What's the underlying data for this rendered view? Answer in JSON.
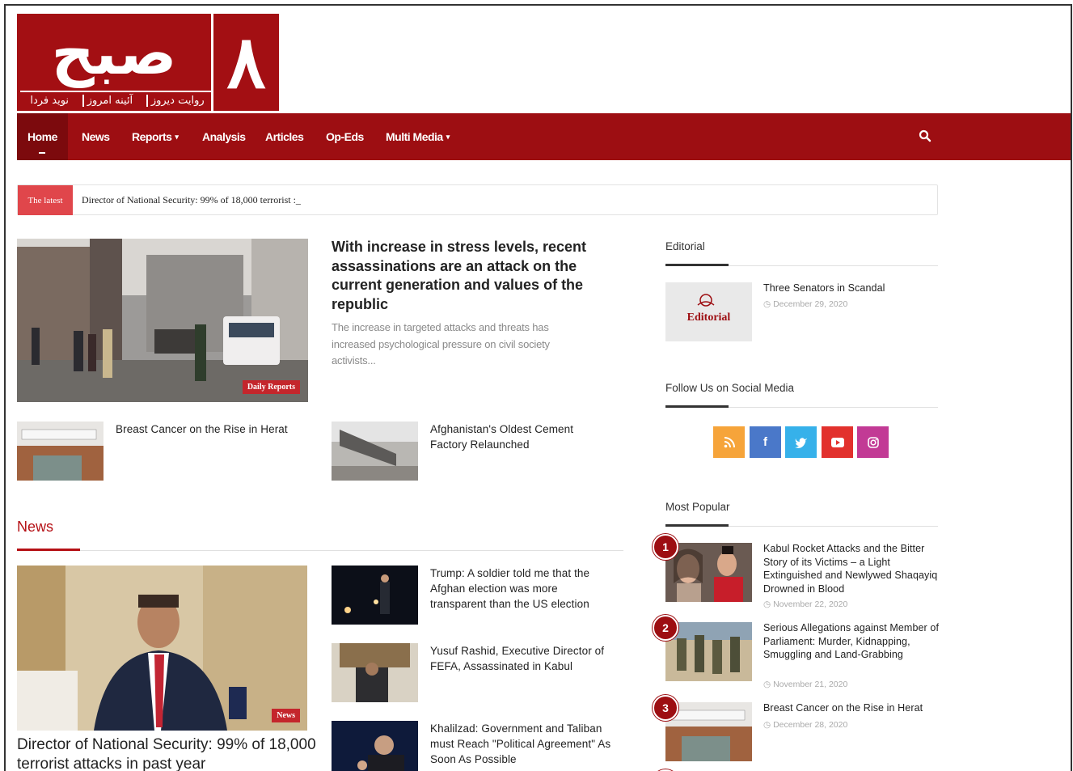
{
  "logo": {
    "main": "صبح",
    "number": "۸",
    "tagline": [
      "روایت دیروز",
      "آئینه امروز",
      "نوید فردا"
    ]
  },
  "nav": {
    "items": [
      {
        "label": "Home",
        "active": true
      },
      {
        "label": "News"
      },
      {
        "label": "Reports",
        "dropdown": true
      },
      {
        "label": "Analysis"
      },
      {
        "label": "Articles"
      },
      {
        "label": "Op-Eds"
      },
      {
        "label": "Multi Media",
        "dropdown": true
      }
    ],
    "search_icon": "search-icon",
    "caret": "▾"
  },
  "ticker": {
    "label": "The latest",
    "text": "Director of National Security: 99% of 18,000 terrorist :_"
  },
  "featured": {
    "badge": "Daily Reports",
    "title": "With increase in stress levels, recent assassinations are an attack on the current generation and values of the republic",
    "excerpt": "The increase in targeted attacks and threats has increased psychological pressure on civil society activists..."
  },
  "small_posts": [
    {
      "title": "Breast Cancer on the Rise in Herat"
    },
    {
      "title": "Afghanistan's Oldest Cement Factory Relaunched"
    }
  ],
  "news": {
    "section_title": "News",
    "main": {
      "badge": "News",
      "title": "Director of National Security: 99% of 18,000 terrorist attacks in past year"
    },
    "list": [
      {
        "title": "Trump: A soldier told me that the Afghan election was more transparent than the US election"
      },
      {
        "title": "Yusuf Rashid, Executive Director of FEFA, Assassinated in Kabul"
      },
      {
        "title": "Khalilzad: Government and Taliban must Reach \"Political Agreement\" As Soon As Possible"
      }
    ]
  },
  "sidebar": {
    "editorial": {
      "section_title": "Editorial",
      "thumb_label": "Editorial",
      "title": "Three Senators in Scandal",
      "date": "December 29, 2020"
    },
    "social": {
      "section_title": "Follow Us on Social Media",
      "icons": [
        {
          "name": "rss-icon",
          "glyph": "⌇",
          "color": "#f6a43a"
        },
        {
          "name": "facebook-icon",
          "glyph": "f",
          "color": "#4a78c9"
        },
        {
          "name": "twitter-icon",
          "glyph": "✦",
          "color": "#36b1ea"
        },
        {
          "name": "youtube-icon",
          "glyph": "▶",
          "color": "#e2312d"
        },
        {
          "name": "instagram-icon",
          "glyph": "◎",
          "color": "#c23a95"
        }
      ]
    },
    "popular": {
      "section_title": "Most Popular",
      "items": [
        {
          "rank": "1",
          "title": "Kabul Rocket Attacks and the Bitter Story of its Victims – a Light Extinguished and Newlywed Shaqayiq Drowned in Blood",
          "date": "November 22, 2020"
        },
        {
          "rank": "2",
          "title": "Serious Allegations against Member of Parliament: Murder, Kidnapping, Smuggling and Land-Grabbing",
          "date": "November 21, 2020"
        },
        {
          "rank": "3",
          "title": "Breast Cancer on the Rise in Herat",
          "date": "December 28, 2020"
        }
      ]
    }
  },
  "colors": {
    "brand": "#9d0e12",
    "accent": "#b51015"
  }
}
